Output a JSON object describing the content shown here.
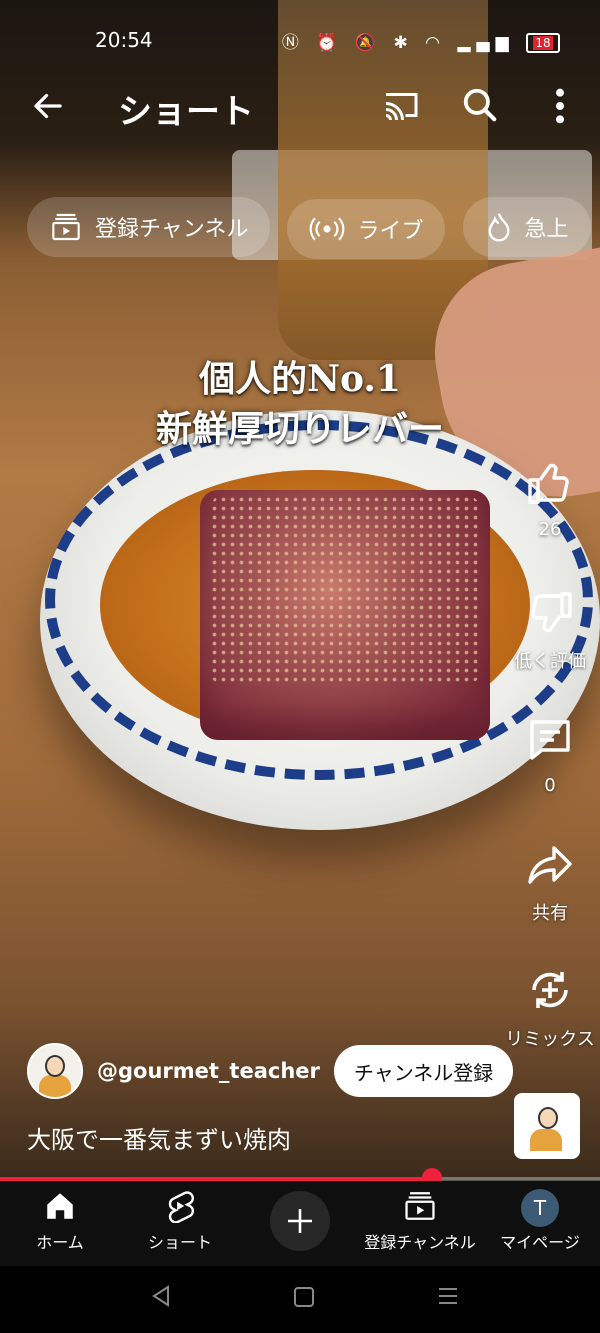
{
  "status_bar": {
    "time": "20:54",
    "battery": "18"
  },
  "topbar": {
    "title": "ショート"
  },
  "chips": [
    {
      "label": "登録チャンネル",
      "icon": "subscriptions-icon"
    },
    {
      "label": "ライブ",
      "icon": "live-icon"
    },
    {
      "label": "急上",
      "icon": "trending-icon"
    }
  ],
  "video_overlay": {
    "line1": "個人的No.1",
    "line2": "新鮮厚切りレバー"
  },
  "actions": {
    "like_count": "26",
    "dislike_label": "低く評価",
    "comment_count": "0",
    "share_label": "共有",
    "remix_label": "リミックス"
  },
  "channel": {
    "handle": "@gourmet_teacher",
    "subscribe_label": "チャンネル登録"
  },
  "video": {
    "title": "大阪で一番気まずい焼肉",
    "progress_fraction": 0.72
  },
  "bottom_nav": {
    "home": "ホーム",
    "shorts": "ショート",
    "subscriptions": "登録チャンネル",
    "mypage": "マイページ",
    "profile_initial": "T"
  },
  "colors": {
    "accent": "#f0213d",
    "nav_bg": "#0f0f0f"
  }
}
